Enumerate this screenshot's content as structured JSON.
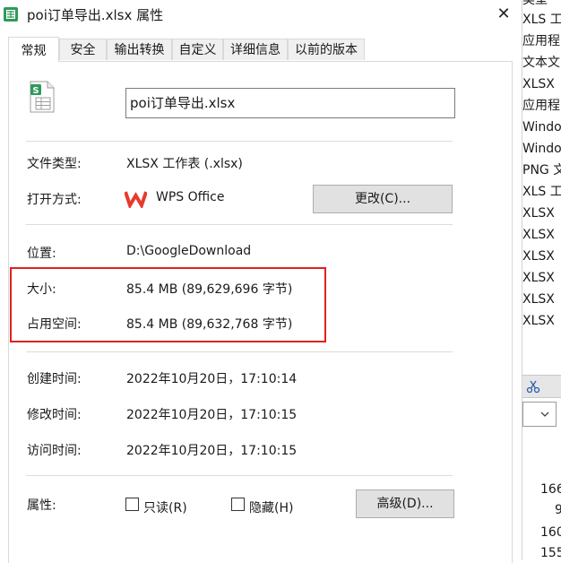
{
  "window": {
    "title": "poi订单导出.xlsx 属性",
    "close_glyph": "✕"
  },
  "tabs": [
    {
      "label": "常规",
      "active": true
    },
    {
      "label": "安全"
    },
    {
      "label": "输出转换"
    },
    {
      "label": "自定义"
    },
    {
      "label": "详细信息"
    },
    {
      "label": "以前的版本"
    }
  ],
  "general": {
    "file_name": "poi订单导出.xlsx",
    "file_icon": "spreadsheet-file-icon",
    "file_type_label": "文件类型:",
    "file_type_value": "XLSX 工作表 (.xlsx)",
    "opens_with_label": "打开方式:",
    "opens_with_app": "WPS Office",
    "opens_with_icon": "wps-logo-icon",
    "change_button": "更改(C)...",
    "location_label": "位置:",
    "location_value": "D:\\GoogleDownload",
    "size_label": "大小:",
    "size_value": "85.4 MB (89,629,696 字节)",
    "size_on_disk_label": "占用空间:",
    "size_on_disk_value": "85.4 MB (89,632,768 字节)",
    "created_label": "创建时间:",
    "created_value": "2022年10月20日，17:10:14",
    "modified_label": "修改时间:",
    "modified_value": "2022年10月20日，17:10:15",
    "accessed_label": "访问时间:",
    "accessed_value": "2022年10月20日，17:10:15",
    "attributes_label": "属性:",
    "readonly_label": "只读(R)",
    "hidden_label": "隐藏(H)",
    "advanced_button": "高级(D)..."
  },
  "colors": {
    "highlight_border": "#e02020",
    "excel_green": "#2e9a5a",
    "wps_red": "#e83a2f"
  },
  "background_window": {
    "rows": [
      "类型",
      "XLS 工",
      "应用程",
      "文本文",
      "XLSX ",
      "应用程",
      "Windo",
      "Windo",
      "PNG 文",
      "XLS 工",
      "XLSX ",
      "XLSX ",
      "XLSX ",
      "XLSX ",
      "XLSX ",
      "XLSX "
    ],
    "numbers": [
      "166",
      "9",
      "160",
      "155"
    ]
  }
}
